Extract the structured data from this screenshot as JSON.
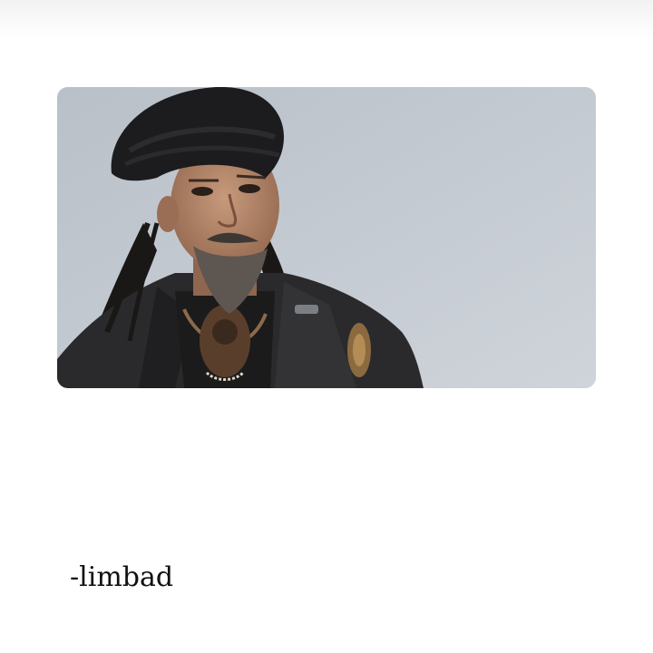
{
  "caption": {
    "text": "-limbad"
  },
  "colors": {
    "background": "#ffffff",
    "photo_wall": "#c2c8d0",
    "jacket": "#2a2a2c",
    "turban": "#1c1c1e",
    "skin": "#b48a6e"
  }
}
